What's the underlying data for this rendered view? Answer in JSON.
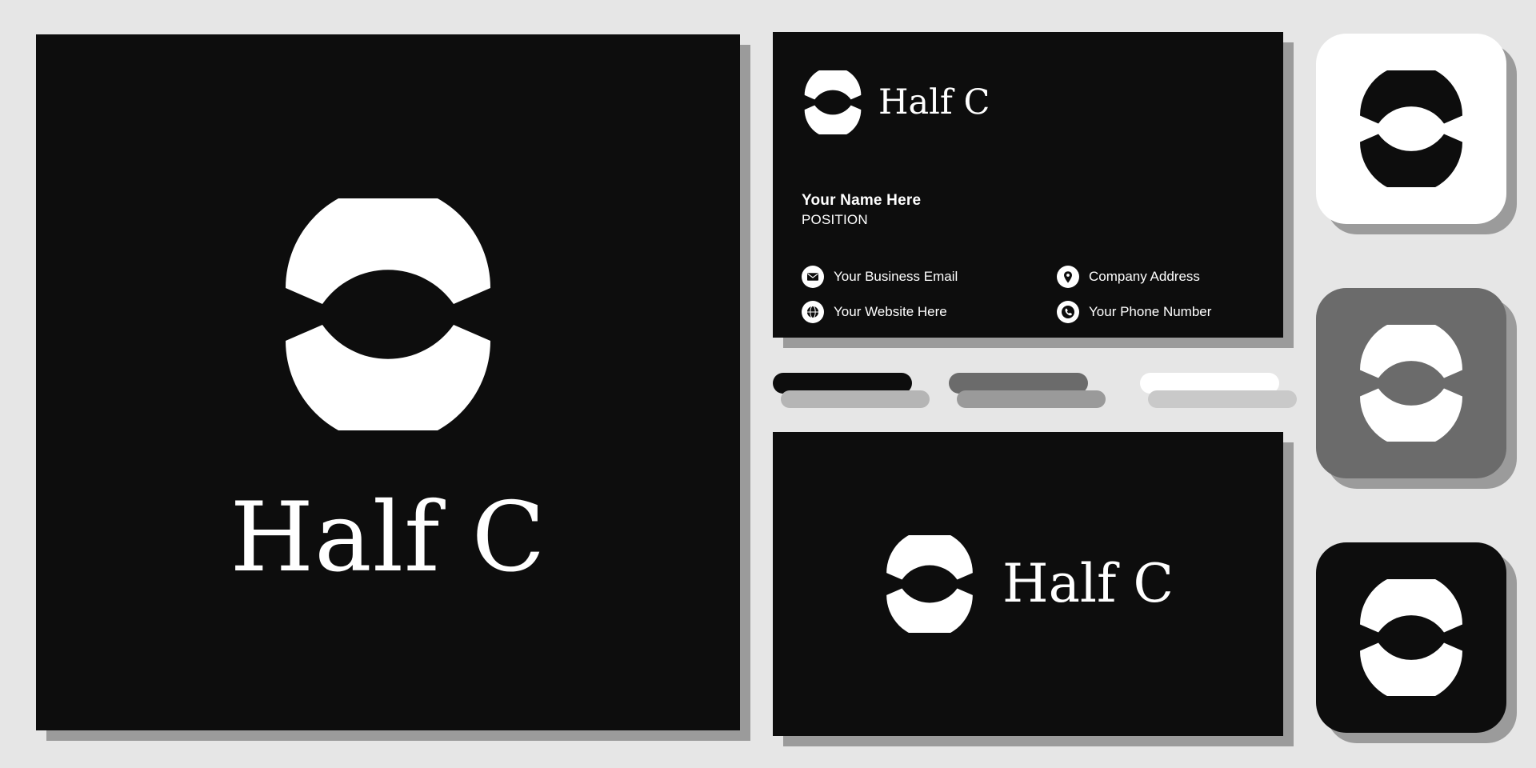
{
  "brand": {
    "name": "Half C",
    "logo_icon": "half-circle-split-icon",
    "colors": {
      "background": "#e6e6e6",
      "ink": "#0d0d0d",
      "white": "#ffffff",
      "gray": "#6b6b6b",
      "shadow": "#9b9b9b"
    }
  },
  "main_card": {
    "wordmark": "Half C",
    "mark_icon": "half-circle-split-icon"
  },
  "business_card": {
    "logo_text": "Half C",
    "person_name": "Your Name Here",
    "position": "POSITION",
    "contacts": [
      {
        "icon": "envelope-icon",
        "label": "Your Business Email"
      },
      {
        "icon": "globe-icon",
        "label": "Your Website Here"
      },
      {
        "icon": "location-pin-icon",
        "label": "Company Address"
      },
      {
        "icon": "phone-icon",
        "label": "Your Phone Number"
      }
    ]
  },
  "color_swatches": [
    {
      "name": "swatch-black",
      "top": "#0d0d0d",
      "bottom": "#b5b5b5"
    },
    {
      "name": "swatch-gray",
      "top": "#6b6b6b",
      "bottom": "#9a9a9a"
    },
    {
      "name": "swatch-white",
      "top": "#ffffff",
      "bottom": "#c9c9c9"
    }
  ],
  "horizontal_card": {
    "wordmark": "Half C",
    "mark_icon": "half-circle-split-icon"
  },
  "app_icons": [
    {
      "name": "app-icon-light",
      "background": "#ffffff",
      "mark_color": "#0d0d0d"
    },
    {
      "name": "app-icon-gray",
      "background": "#6b6b6b",
      "mark_color": "#ffffff"
    },
    {
      "name": "app-icon-dark",
      "background": "#0d0d0d",
      "mark_color": "#ffffff"
    }
  ]
}
